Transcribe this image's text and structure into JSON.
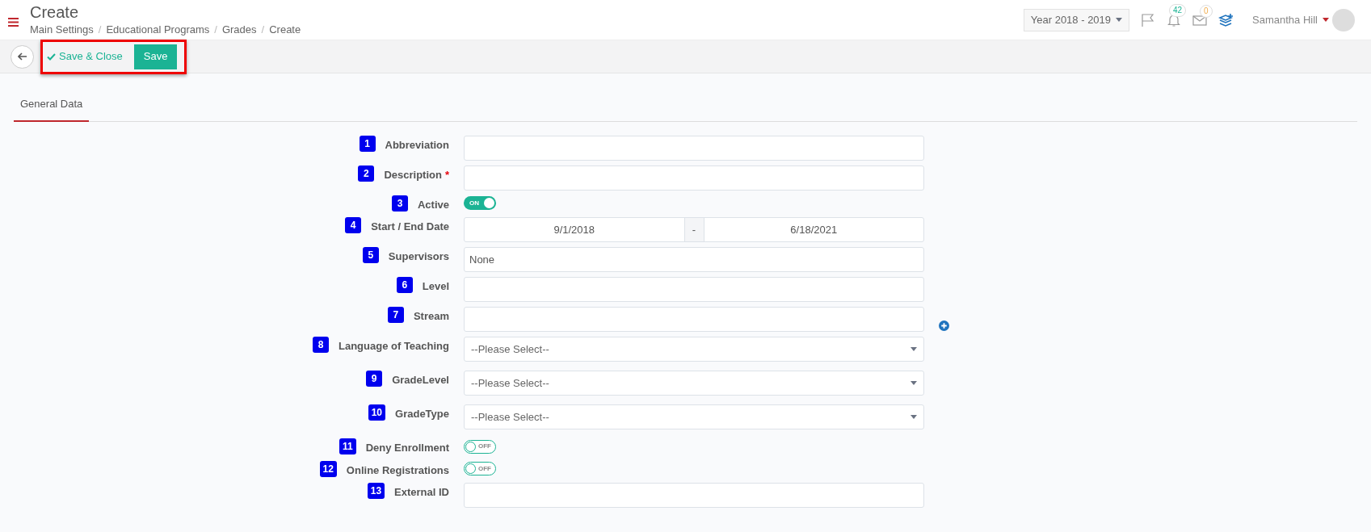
{
  "header": {
    "title": "Create",
    "breadcrumbs": [
      "Main Settings",
      "Educational Programs",
      "Grades",
      "Create"
    ],
    "breadcrumb_separator": "/",
    "required_mark": "*",
    "year": "Year 2018 - 2019",
    "notifications": "42",
    "messages": "0",
    "user": "Samantha Hill"
  },
  "toolbar": {
    "save_close": "Save & Close",
    "save": "Save"
  },
  "tabs": [
    {
      "label": "General Data",
      "selected": true
    }
  ],
  "fields": [
    {
      "kind": "text",
      "badge": "1",
      "label": "Abbreviation",
      "required": false
    },
    {
      "kind": "text",
      "badge": "2",
      "label": "Description",
      "required": true
    },
    {
      "kind": "toggle",
      "badge": "3",
      "label": "Active",
      "on": true,
      "text": "ON"
    },
    {
      "kind": "daterange",
      "badge": "4",
      "label": "Start / End Date",
      "start": "9/1/2018",
      "separator": "-",
      "end": "6/18/2021"
    },
    {
      "kind": "text",
      "badge": "5",
      "label": "Supervisors",
      "required": false,
      "value": "None"
    },
    {
      "kind": "text",
      "badge": "6",
      "label": "Level",
      "required": false
    },
    {
      "kind": "text",
      "badge": "7",
      "label": "Stream",
      "required": false,
      "add": true
    },
    {
      "kind": "select",
      "badge": "8",
      "label": "Language of Teaching",
      "placeholder": "--Please Select--"
    },
    {
      "kind": "select",
      "badge": "9",
      "label": "GradeLevel",
      "placeholder": "--Please Select--"
    },
    {
      "kind": "select",
      "badge": "10",
      "label": "GradeType",
      "placeholder": "--Please Select--"
    },
    {
      "kind": "toggle",
      "badge": "11",
      "label": "Deny Enrollment",
      "on": false,
      "text": "OFF"
    },
    {
      "kind": "toggle",
      "badge": "12",
      "label": "Online Registrations",
      "on": false,
      "text": "OFF"
    },
    {
      "kind": "text",
      "badge": "13",
      "label": "External ID",
      "required": false
    }
  ]
}
